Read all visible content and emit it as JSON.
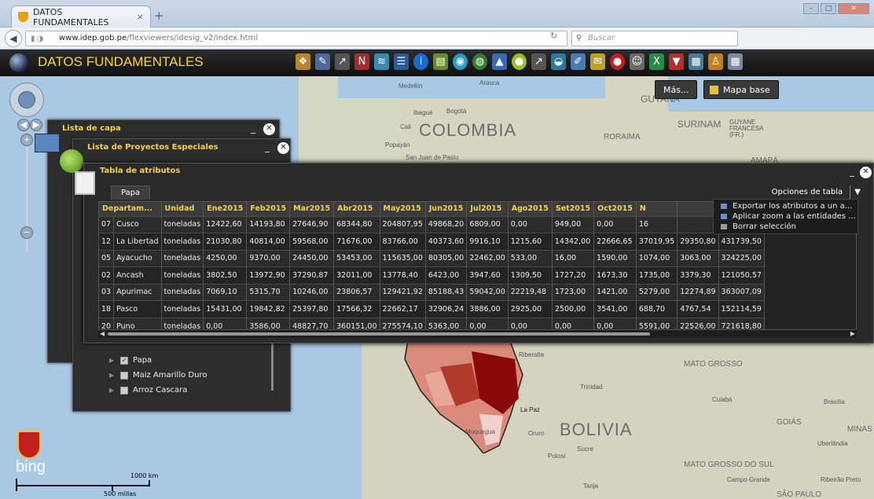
{
  "browser": {
    "tab_title": "DATOS FUNDAMENTALES",
    "tab_close": "×",
    "new_tab": "+",
    "url_domain": "www.idep.gob.pe",
    "url_path": "/flexviewers/idesig_v2/index.html",
    "search_placeholder": "Buscar"
  },
  "app": {
    "title": "DATOS FUNDAMENTALES",
    "map_buttons": {
      "more": "Más...",
      "basemap": "Mapa base"
    }
  },
  "map_labels": {
    "colombia": "COLOMBIA",
    "bolivia": "BOLIVIA",
    "guyana": "GUYANA",
    "suriname": "SURINAM",
    "guyane": "GUYANE FRANCESA (FR.)",
    "roraima": "RORAIMA",
    "amapa": "AMAPÁ",
    "mato_grosso": "MATO GROSSO",
    "mato_grosso_sul": "MATO GROSSO DO SUL",
    "goias": "GOIÁS",
    "minas": "MINAS",
    "medellin": "Medellín",
    "bogota": "Bogotá",
    "ibague": "Ibagué",
    "cali": "Cali",
    "popayan": "Popayán",
    "san_juan": "San Juan de Pasto",
    "arauca": "Arauca",
    "la_paz": "La Paz",
    "oruro": "Oruro",
    "potosi": "Potosí",
    "sucre": "Sucre",
    "tarija": "Tarija",
    "trinidad": "Trinidad",
    "cuiaba": "Cuiabá",
    "brasilia": "Brasília",
    "uberlandia": "Uberlândia",
    "campo_grande": "Campo Grande",
    "ribeirao": "Ribeirão Preto",
    "sao_paulo": "SÃO PAULO",
    "moquegua": "Moquegua",
    "riberalta": "Riberalta"
  },
  "panels": {
    "layer_list": {
      "title": "Lista de capa",
      "minimize": "_",
      "close": "✕"
    },
    "projects": {
      "title": "Lista de Proyectos Especiales",
      "minimize": "_",
      "close": "✕",
      "items": [
        {
          "label": "Papa",
          "checked": true
        },
        {
          "label": "Maiz Amarillo Duro",
          "checked": false
        },
        {
          "label": "Arroz Cascara",
          "checked": false
        }
      ]
    }
  },
  "attribute_table": {
    "title": "Tabla de atributos",
    "minimize": "_",
    "close": "✕",
    "tab_label": "Papa",
    "options_label": "Opciones de tabla",
    "options_arrow": "▼",
    "menu": [
      "Exportar los atributos a un a...",
      "Aplicar zoom a las entidades ...",
      "Borrar selección"
    ],
    "columns": [
      "Departam...",
      "Unidad",
      "Ene2015",
      "Feb2015",
      "Mar2015",
      "Abr2015",
      "May2015",
      "Jun2015",
      "Jul2015",
      "Ago2015",
      "Set2015",
      "Oct2015",
      "N",
      "",
      ""
    ],
    "rows": [
      [
        "07",
        "Cusco",
        "toneladas",
        "12422,60",
        "14193,80",
        "27646,90",
        "68344,80",
        "204807,95",
        "49868,20",
        "6809,00",
        "0,00",
        "949,00",
        "0,00",
        "16",
        "",
        ""
      ],
      [
        "12",
        "La Libertad",
        "toneladas",
        "21030,80",
        "40814,00",
        "59568,00",
        "71676,00",
        "83766,00",
        "40373,60",
        "9916,10",
        "1215,60",
        "14342,00",
        "22666,65",
        "37019,95",
        "29350,80",
        "431739,50"
      ],
      [
        "05",
        "Ayacucho",
        "toneladas",
        "4250,00",
        "9370,00",
        "24450,00",
        "53453,00",
        "115635,00",
        "80305,00",
        "22462,00",
        "533,00",
        "16,00",
        "1590,00",
        "1074,00",
        "3063,00",
        "324225,00"
      ],
      [
        "02",
        "Ancash",
        "toneladas",
        "3802,50",
        "13972,90",
        "37290,87",
        "32011,00",
        "13778,40",
        "6423,00",
        "3947,60",
        "1309,50",
        "1727,20",
        "1673,30",
        "1735,00",
        "3379,30",
        "121050,57"
      ],
      [
        "03",
        "Apurimac",
        "toneladas",
        "7069,10",
        "5315,70",
        "10246,00",
        "23806,57",
        "129421,92",
        "85188,43",
        "59042,00",
        "22219,48",
        "1723,00",
        "1421,00",
        "5279,00",
        "12274,89",
        "363007,09"
      ],
      [
        "18",
        "Pasco",
        "toneladas",
        "15431,00",
        "19842,82",
        "25397,80",
        "17566,32",
        "22662,17",
        "32906,24",
        "3886,00",
        "2925,00",
        "2500,00",
        "3541,00",
        "688,70",
        "4767,54",
        "152114,59"
      ],
      [
        "20",
        "Puno",
        "toneladas",
        "0,00",
        "3586,00",
        "48827,70",
        "360151,00",
        "275574,10",
        "5363,00",
        "0,00",
        "0,00",
        "0,00",
        "0,00",
        "5591,00",
        "22526,00",
        "721618,80"
      ]
    ]
  },
  "scale": {
    "km": "1000 km",
    "mi": "500 millas"
  },
  "bing": "bing"
}
